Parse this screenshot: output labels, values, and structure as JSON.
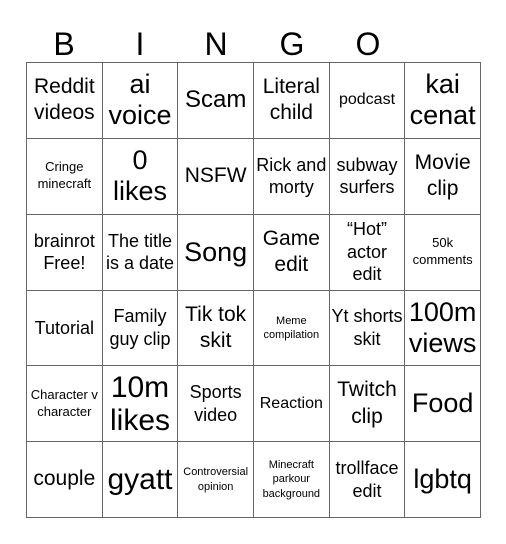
{
  "header": {
    "letters": [
      "B",
      "I",
      "N",
      "G",
      "O"
    ]
  },
  "cells": [
    [
      {
        "text": "Reddit videos",
        "size": "s5"
      },
      {
        "text": "ai voice",
        "size": "s7"
      },
      {
        "text": "Scam",
        "size": "s6"
      },
      {
        "text": "Literal child",
        "size": "s5"
      },
      {
        "text": "podcast",
        "size": "s3"
      },
      {
        "text": "kai cenat",
        "size": "s7"
      }
    ],
    [
      {
        "text": "Cringe minecraft",
        "size": "s2"
      },
      {
        "text": "0 likes",
        "size": "s7"
      },
      {
        "text": "NSFW",
        "size": "s5"
      },
      {
        "text": "Rick and morty",
        "size": "s4"
      },
      {
        "text": "subway surfers",
        "size": "s4"
      },
      {
        "text": "Movie clip",
        "size": "s5"
      }
    ],
    [
      {
        "text": "brainrot Free!",
        "size": "s4"
      },
      {
        "text": "The title is a date",
        "size": "s4"
      },
      {
        "text": "Song",
        "size": "s7"
      },
      {
        "text": "Game edit",
        "size": "s5"
      },
      {
        "text": "“Hot” actor edit",
        "size": "s4"
      },
      {
        "text": "50k comments",
        "size": "s2"
      }
    ],
    [
      {
        "text": "Tutorial",
        "size": "s4"
      },
      {
        "text": "Family guy clip",
        "size": "s4"
      },
      {
        "text": "Tik tok skit",
        "size": "s5"
      },
      {
        "text": "Meme compilation",
        "size": "s1"
      },
      {
        "text": "Yt shorts skit",
        "size": "s4"
      },
      {
        "text": "100m views",
        "size": "s7"
      }
    ],
    [
      {
        "text": "Character v character",
        "size": "s2"
      },
      {
        "text": "10m likes",
        "size": "s8"
      },
      {
        "text": "Sports video",
        "size": "s4"
      },
      {
        "text": "Reaction",
        "size": "s3"
      },
      {
        "text": "Twitch clip",
        "size": "s5"
      },
      {
        "text": "Food",
        "size": "s7"
      }
    ],
    [
      {
        "text": "couple",
        "size": "s5"
      },
      {
        "text": "gyatt",
        "size": "s8"
      },
      {
        "text": "Controversial opinion",
        "size": "s1"
      },
      {
        "text": "Minecraft parkour background",
        "size": "s1"
      },
      {
        "text": "trollface edit",
        "size": "s4"
      },
      {
        "text": "lgbtq",
        "size": "s7"
      }
    ]
  ]
}
